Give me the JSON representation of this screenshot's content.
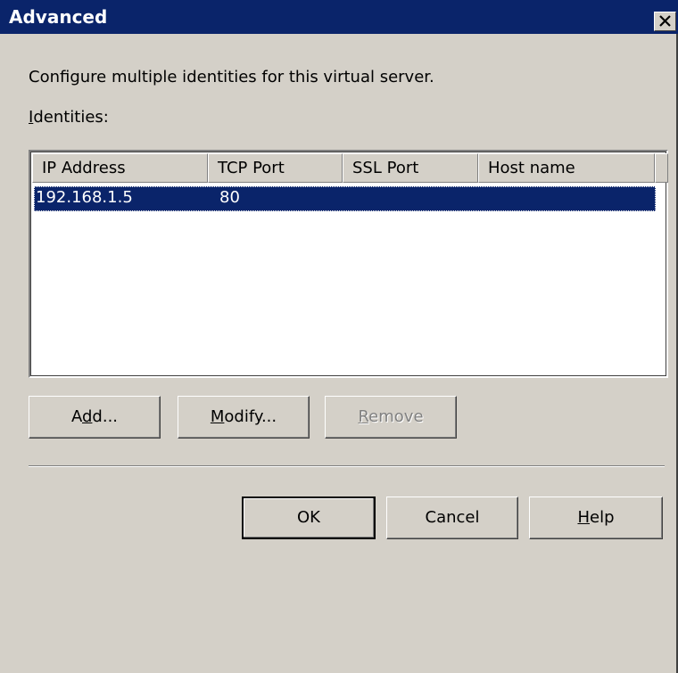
{
  "window": {
    "title": "Advanced"
  },
  "description": "Configure multiple identities for this virtual server.",
  "identities_label": {
    "pre": "",
    "accel": "I",
    "post": "dentities:"
  },
  "table": {
    "columns": [
      "IP Address",
      "TCP Port",
      "SSL Port",
      "Host name"
    ],
    "rows": [
      {
        "ip": "192.168.1.5",
        "tcp": "80",
        "ssl": "",
        "host": ""
      }
    ]
  },
  "buttons": {
    "add": {
      "pre": "A",
      "accel": "d",
      "post": "d..."
    },
    "modify": {
      "pre": "",
      "accel": "M",
      "post": "odify..."
    },
    "remove": {
      "pre": "",
      "accel": "R",
      "post": "emove"
    },
    "ok": {
      "label": "OK"
    },
    "cancel": {
      "label": "Cancel"
    },
    "help": {
      "pre": "",
      "accel": "H",
      "post": "elp"
    }
  },
  "colors": {
    "titlebar": "#0a246a",
    "face": "#d4d0c8",
    "selection": "#0a246a"
  }
}
